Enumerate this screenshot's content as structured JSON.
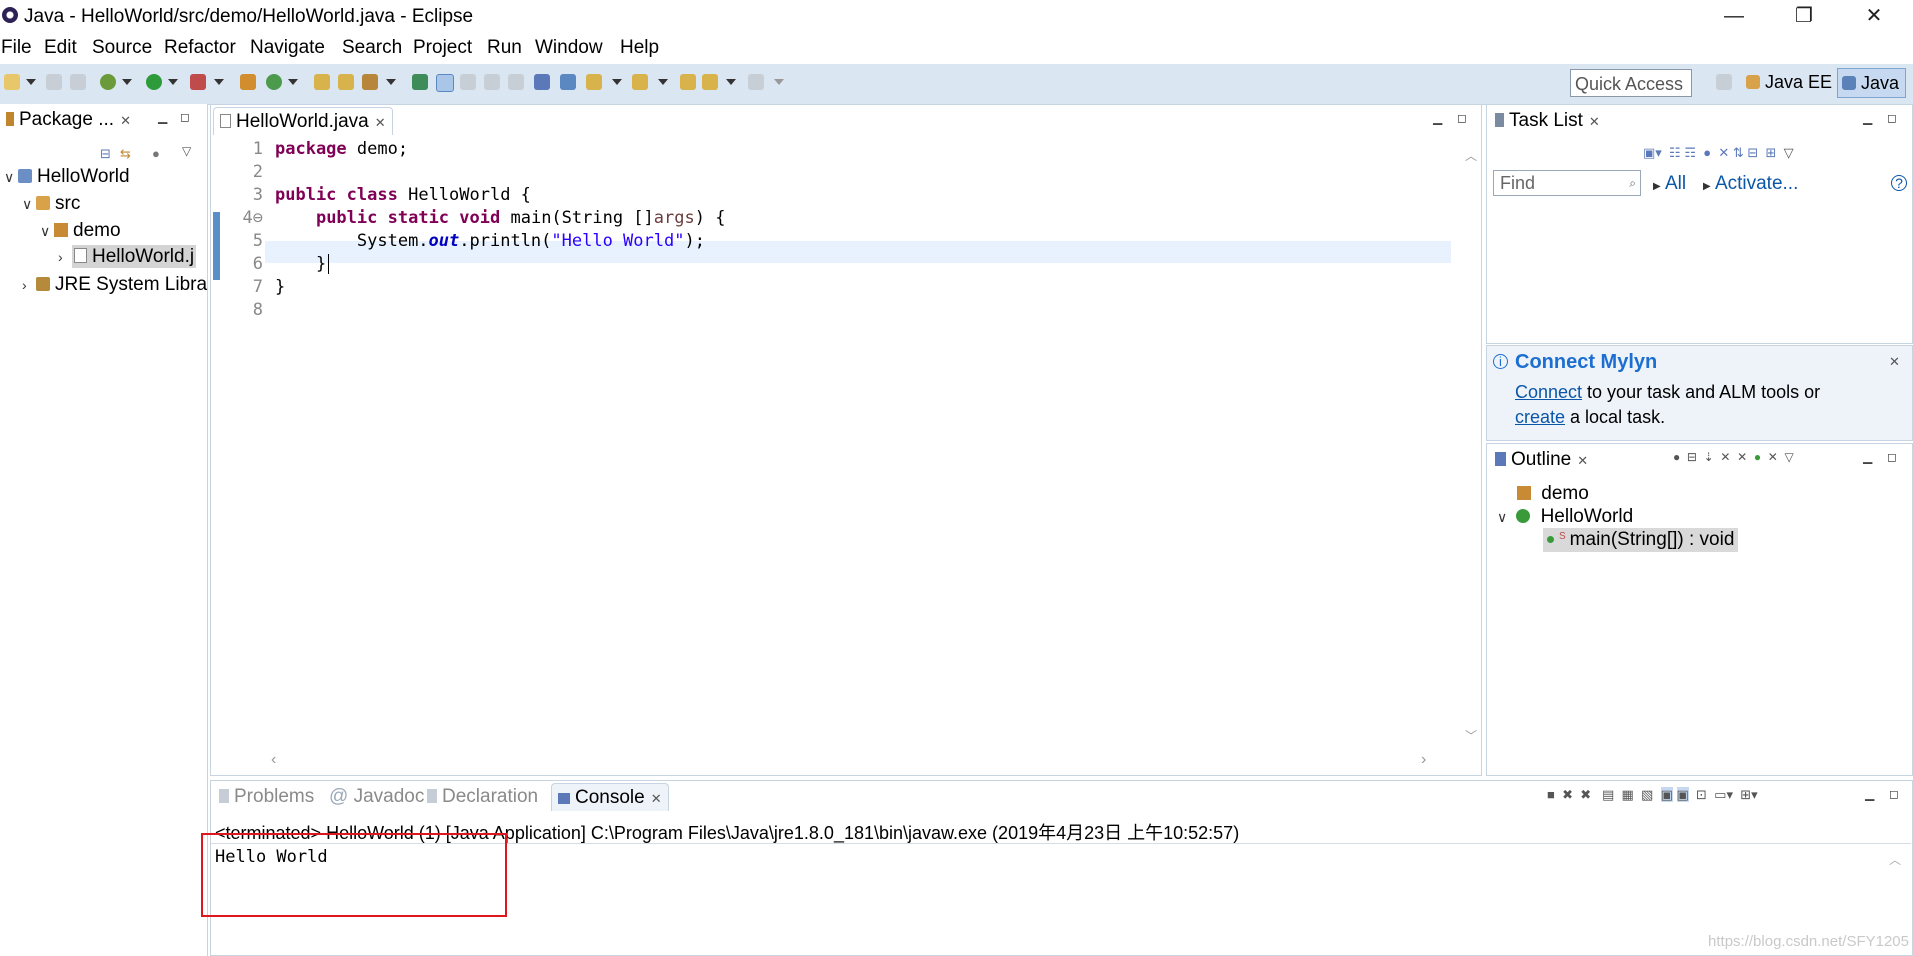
{
  "window": {
    "title": "Java - HelloWorld/src/demo/HelloWorld.java - Eclipse",
    "minimize": "—",
    "restore": "❐",
    "close": "✕"
  },
  "menu": [
    "File",
    "Edit",
    "Source",
    "Refactor",
    "Navigate",
    "Search",
    "Project",
    "Run",
    "Window",
    "Help"
  ],
  "toolbar": {
    "quick_access_placeholder": "Quick Access",
    "perspectives": [
      "Java EE",
      "Java"
    ]
  },
  "package_explorer": {
    "tab_label": "Package ...",
    "tree": [
      {
        "label": "HelloWorld",
        "chevron": "∨"
      },
      {
        "label": "src",
        "chevron": "∨"
      },
      {
        "label": "demo",
        "chevron": "∨"
      },
      {
        "label": "HelloWorld.j",
        "chevron": "›"
      },
      {
        "label": "JRE System Libra",
        "chevron": "›"
      }
    ]
  },
  "editor": {
    "tab_label": "HelloWorld.java",
    "line_numbers": [
      "1",
      "2",
      "3",
      "4⊖",
      "5",
      "6",
      "7",
      "8"
    ],
    "code": {
      "l1_kw": "package",
      "l1_rest": " demo;",
      "l3_kw1": "public",
      "l3_kw2": "class",
      "l3_rest": " HelloWorld {",
      "l4_kw1": "public",
      "l4_kw2": "static",
      "l4_kw3": "void",
      "l4_mid": " main(String []",
      "l4_var": "args",
      "l4_end": ") {",
      "l5_start": "System.",
      "l5_field": "out",
      "l5_mid": ".println(",
      "l5_str": "\"Hello World\"",
      "l5_end": ");",
      "l6": "}",
      "l7": "}"
    }
  },
  "task_list": {
    "tab_label": "Task List",
    "find_placeholder": "Find",
    "all_label": "All",
    "activate_label": "Activate..."
  },
  "mylyn": {
    "title": "Connect Mylyn",
    "connect_link": "Connect",
    "text1": " to your task and ALM tools or",
    "create_link": "create",
    "text2": " a local task."
  },
  "outline": {
    "tab_label": "Outline",
    "items": [
      "demo",
      "HelloWorld",
      "main(String[]) : void"
    ]
  },
  "bottom_tabs": [
    "Problems",
    "Javadoc",
    "Declaration",
    "Console"
  ],
  "console": {
    "status": "<terminated> HelloWorld (1) [Java Application] C:\\Program Files\\Java\\jre1.8.0_181\\bin\\javaw.exe (2019年4月23日 上午10:52:57)",
    "output": "Hello World"
  },
  "watermark": "https://blog.csdn.net/SFY1205",
  "colors": {
    "toolbar_bg": "#dbe6f3",
    "keyword": "#7f0055",
    "string": "#2a00ff",
    "field": "#0000c0",
    "highlight_box": "#e0161e"
  }
}
